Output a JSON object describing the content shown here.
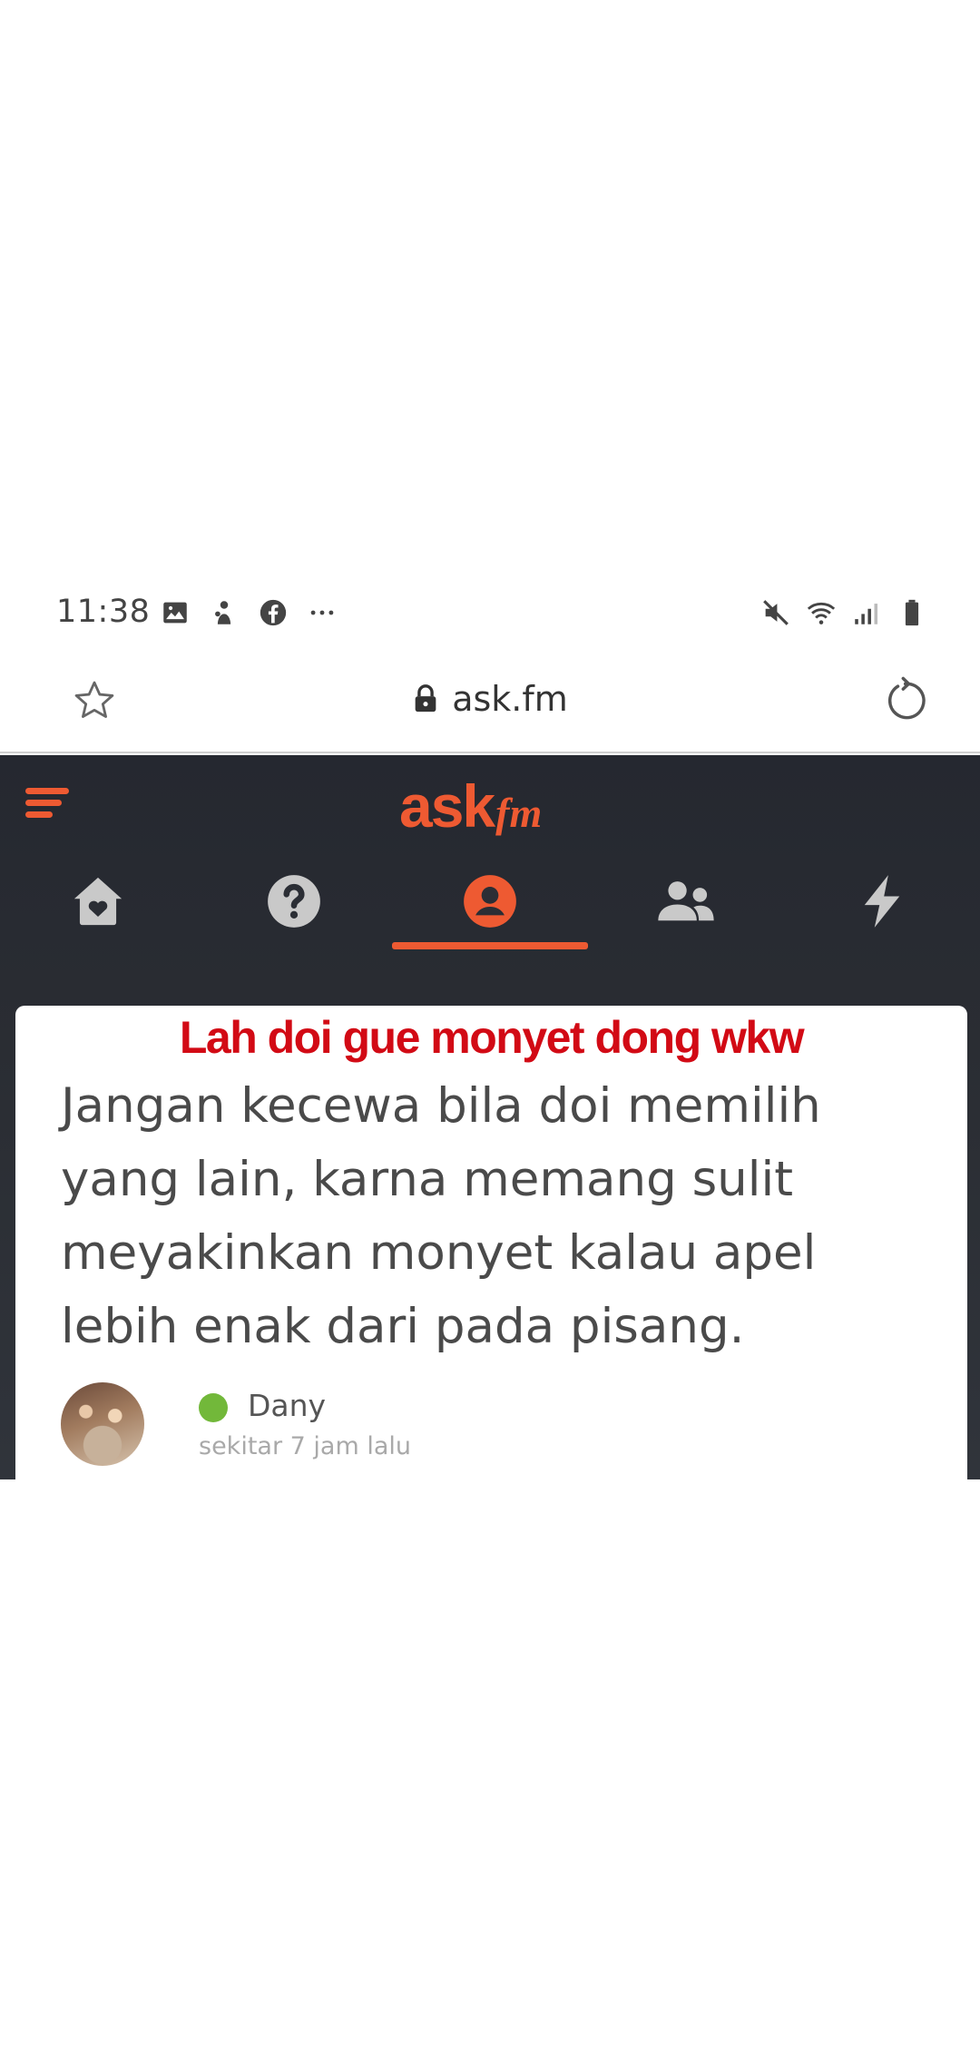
{
  "status_bar": {
    "time": "11:38",
    "left_icons": [
      "gallery-icon",
      "app-icon",
      "facebook-icon",
      "more-dots-icon"
    ],
    "right_icons": [
      "mute-icon",
      "wifi-icon",
      "signal-icon",
      "battery-icon"
    ]
  },
  "browser": {
    "url": "ask.fm",
    "icons": [
      "star-icon",
      "lock-icon",
      "reload-icon"
    ]
  },
  "app": {
    "logo_main": "ask",
    "logo_suffix": "fm",
    "accent_color": "#ee5a32",
    "tabs": [
      {
        "name": "home",
        "icon": "home-heart-icon",
        "active": false
      },
      {
        "name": "questions",
        "icon": "question-icon",
        "active": false
      },
      {
        "name": "profile",
        "icon": "profile-icon",
        "active": true
      },
      {
        "name": "friends",
        "icon": "friends-icon",
        "active": false
      },
      {
        "name": "activity",
        "icon": "lightning-icon",
        "active": false
      }
    ]
  },
  "post": {
    "caption": "Lah doi gue monyet dong wkw",
    "caption_color": "#d20a15",
    "answer_lines": [
      "Jangan kecewa bila doi memilih",
      "yang lain, karna memang sulit",
      "meyakinkan monyet kalau apel",
      "lebih enak dari pada pisang."
    ],
    "author": {
      "name": "Dany",
      "time": "sekitar 7 jam lalu",
      "online_color": "#72b83a"
    }
  }
}
